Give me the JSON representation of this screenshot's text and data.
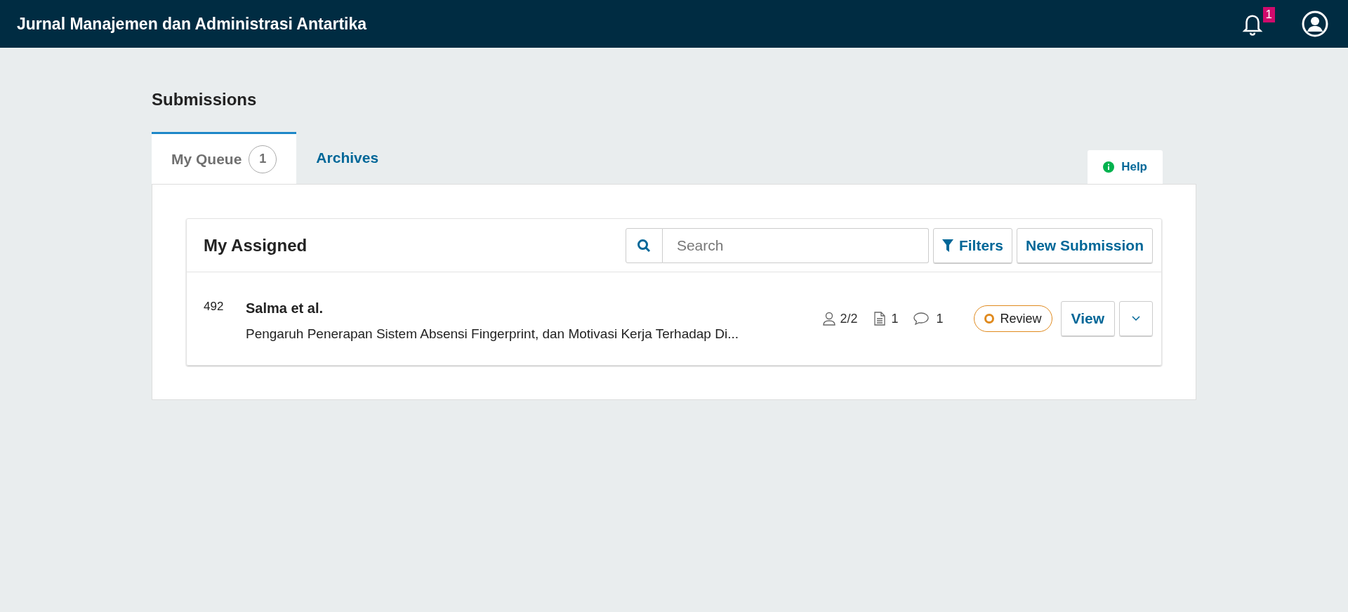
{
  "header": {
    "title": "Jurnal Manajemen dan Administrasi Antartika",
    "notifications": "1"
  },
  "page_title": "Submissions",
  "tabs": [
    {
      "label": "My Queue",
      "count": "1",
      "selected": true
    },
    {
      "label": "Archives",
      "selected": false
    }
  ],
  "help": "Help",
  "list": {
    "title": "My Assigned",
    "search": {
      "placeholder": "Search"
    },
    "filters": "Filters",
    "new_submission": "New Submission",
    "rows": [
      {
        "id": "492",
        "authors": "Salma et al.",
        "title": "Pengaruh Penerapan Sistem Absensi Fingerprint, dan Motivasi Kerja Terhadap Di...",
        "participants": "2/2",
        "files": "1",
        "discussions": "1",
        "stage": {
          "label": "Review",
          "color": "#e08a1e"
        },
        "view": "View"
      }
    ]
  }
}
